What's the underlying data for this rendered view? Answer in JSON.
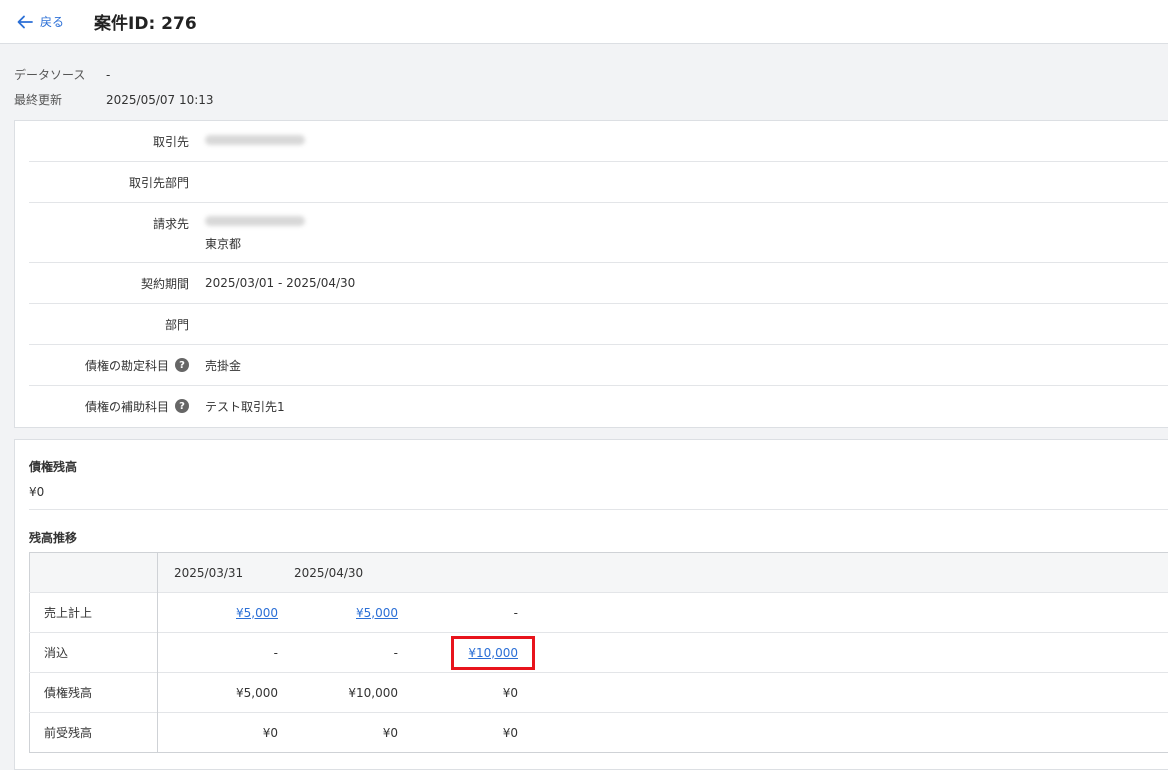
{
  "header": {
    "back_label": "戻る",
    "title": "案件ID: 276"
  },
  "meta": {
    "source_label": "データソース",
    "source_value": "-",
    "updated_label": "最終更新",
    "updated_value": "2025/05/07 10:13"
  },
  "info": {
    "client_label": "取引先",
    "client_dept_label": "取引先部門",
    "billing_label": "請求先",
    "billing_city": "東京都",
    "period_label": "契約期間",
    "period_value": "2025/03/01 - 2025/04/30",
    "dept_label": "部門",
    "account_label": "債権の勘定科目",
    "account_value": "売掛金",
    "subaccount_label": "債権の補助科目",
    "subaccount_value": "テスト取引先1"
  },
  "balance": {
    "title": "債権残高",
    "amount": "¥0",
    "trend_title": "残高推移",
    "columns": [
      "2025/03/31",
      "2025/04/30",
      ""
    ],
    "rows": [
      {
        "label": "売上計上",
        "values": [
          "¥5,000",
          "¥5,000",
          "-"
        ]
      },
      {
        "label": "消込",
        "values": [
          "-",
          "-",
          "¥10,000"
        ]
      },
      {
        "label": "債権残高",
        "values": [
          "¥5,000",
          "¥10,000",
          "¥0"
        ]
      },
      {
        "label": "前受残高",
        "values": [
          "¥0",
          "¥0",
          "¥0"
        ]
      }
    ]
  }
}
